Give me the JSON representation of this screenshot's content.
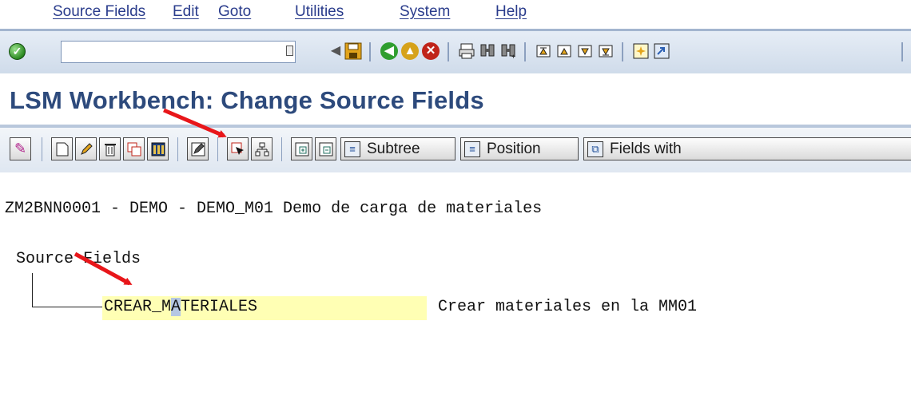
{
  "menu": {
    "items": [
      {
        "label": "Source Fields"
      },
      {
        "label": "Edit"
      },
      {
        "label": "Goto"
      },
      {
        "label": "Utilities"
      },
      {
        "label": "System"
      },
      {
        "label": "Help"
      }
    ]
  },
  "std_toolbar": {
    "command_field": {
      "value": "",
      "placeholder": ""
    },
    "check_glyph": "✓"
  },
  "title": "LSM Workbench: Change Source Fields",
  "app_toolbar": {
    "buttons": [
      {
        "label": "Subtree"
      },
      {
        "label": "Position"
      },
      {
        "label": "Fields with"
      }
    ]
  },
  "content": {
    "header_line": "ZM2BNN0001 - DEMO - DEMO_M01 Demo de carga de materiales",
    "tree_root": "Source Fields",
    "node": {
      "name_before_cursor": "CREAR_M",
      "name_cursor_char": "A",
      "name_after_cursor": "TERIALES",
      "description": "Crear materiales en la MM01"
    }
  },
  "colors": {
    "menu_text": "#2a3c8c",
    "title_text": "#2d4a7c",
    "node_highlight": "#ffffb4",
    "annotation_arrow": "#e8161a"
  }
}
